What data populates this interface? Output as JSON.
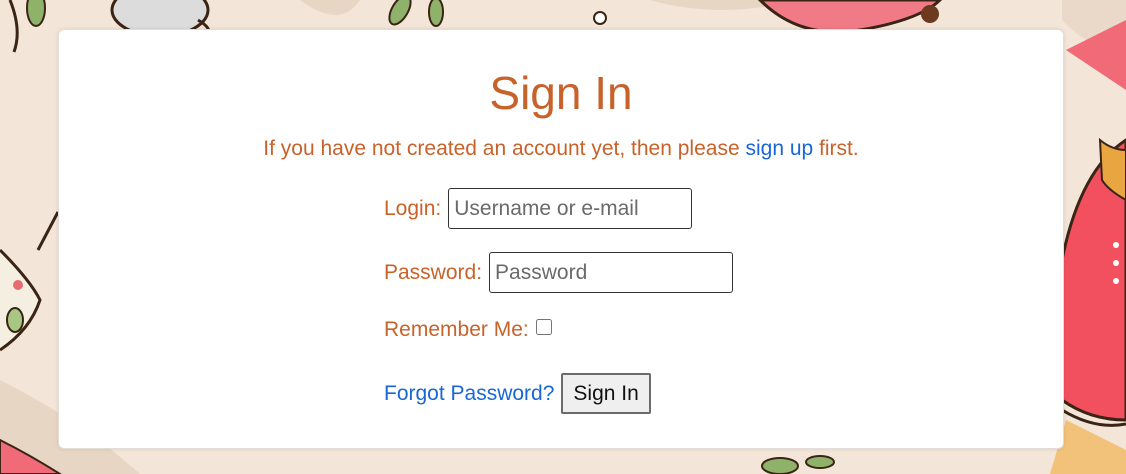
{
  "theme": {
    "accent": "#c8622b",
    "link": "#1a66d6",
    "background": "#f3e6d8"
  },
  "page": {
    "title": "Sign In",
    "intro_before": "If you have not created an account yet, then please ",
    "intro_link": "sign up",
    "intro_after": " first."
  },
  "form": {
    "login_label": "Login:",
    "login_placeholder": "Username or e-mail",
    "login_value": "",
    "password_label": "Password:",
    "password_placeholder": "Password",
    "password_value": "",
    "remember_label": "Remember Me:",
    "remember_checked": false,
    "forgot_link": "Forgot Password?",
    "submit_label": "Sign In"
  }
}
